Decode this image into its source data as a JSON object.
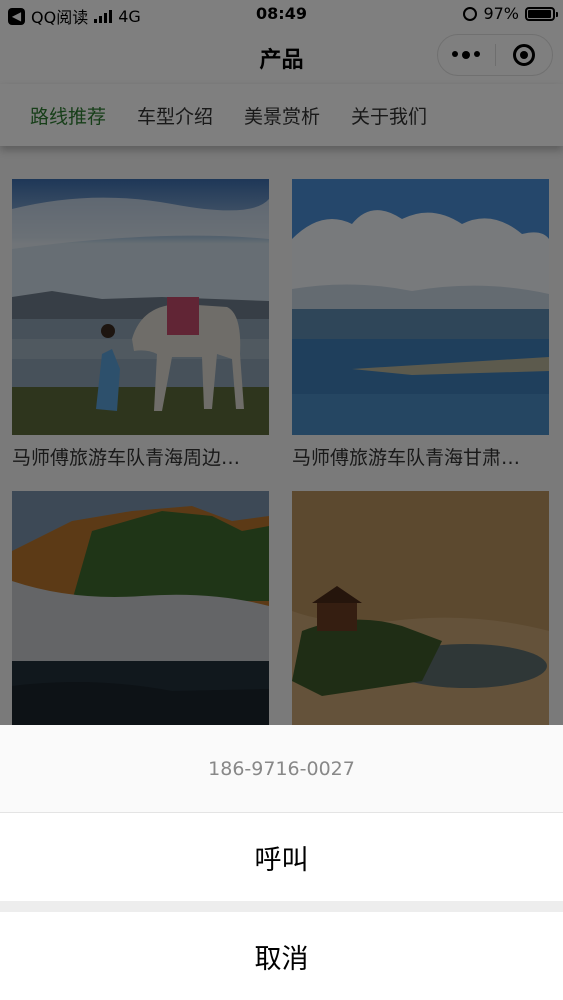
{
  "status_bar": {
    "carrier": "QQ阅读",
    "network": "4G",
    "time": "08:49",
    "battery": "97%",
    "battery_level": 0.97
  },
  "nav": {
    "title": "产品"
  },
  "tabs": [
    {
      "label": "路线推荐",
      "active": true
    },
    {
      "label": "车型介绍",
      "active": false
    },
    {
      "label": "美景赏析",
      "active": false
    },
    {
      "label": "关于我们",
      "active": false
    }
  ],
  "cards": [
    {
      "caption": "马师傅旅游车队青海周边…"
    },
    {
      "caption": "马师傅旅游车队青海甘肃…"
    },
    {
      "caption": ""
    },
    {
      "caption": ""
    }
  ],
  "action_sheet": {
    "phone": "186-9716-0027",
    "call_label": "呼叫",
    "cancel_label": "取消"
  },
  "colors": {
    "active_tab": "#2e7d32",
    "overlay": "rgba(0,0,0,0.5)"
  }
}
